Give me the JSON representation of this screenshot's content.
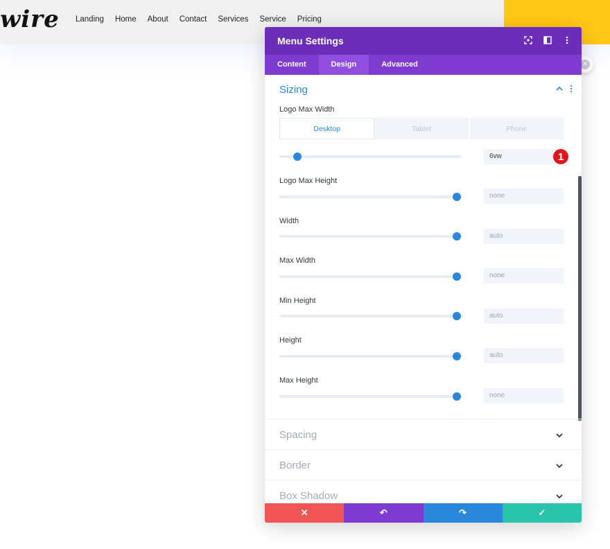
{
  "site": {
    "logo_text": "wire",
    "nav": [
      "Landing",
      "Home",
      "About",
      "Contact",
      "Services",
      "Service",
      "Pricing"
    ],
    "accent_yellow": "#ffc816"
  },
  "modal": {
    "title": "Menu Settings",
    "header_icons": [
      "screenshot-icon",
      "split-view-icon",
      "more-options-icon"
    ],
    "tabs": [
      "Content",
      "Design",
      "Advanced"
    ],
    "active_tab": "Design",
    "colors": {
      "header": "#6c2eb9",
      "tabs": "#7e3bd0",
      "accent": "#2b87da"
    },
    "sizing": {
      "title": "Sizing",
      "logo_max_width": {
        "label": "Logo Max Width",
        "devices": [
          "Desktop",
          "Tablet",
          "Phone"
        ],
        "active_device": "Desktop",
        "value": "6vw",
        "slider_level": 0.08
      },
      "badge": "1",
      "fields": [
        {
          "label": "Logo Max Height",
          "value": "none",
          "slider_level": 1.0
        },
        {
          "label": "Width",
          "value": "auto",
          "slider_level": 1.0
        },
        {
          "label": "Max Width",
          "value": "none",
          "slider_level": 1.0
        },
        {
          "label": "Min Height",
          "value": "auto",
          "slider_level": 1.0
        },
        {
          "label": "Height",
          "value": "auto",
          "slider_level": 1.0
        },
        {
          "label": "Max Height",
          "value": "none",
          "slider_level": 1.0
        }
      ]
    },
    "collapsed_sections": [
      "Spacing",
      "Border",
      "Box Shadow"
    ],
    "footer": {
      "buttons": [
        {
          "name": "cancel-button",
          "icon": "close-icon",
          "glyph": "✕",
          "color": "#ef5555"
        },
        {
          "name": "undo-button",
          "icon": "undo-icon",
          "glyph": "↶",
          "color": "#7d3bcf"
        },
        {
          "name": "redo-button",
          "icon": "redo-icon",
          "glyph": "↷",
          "color": "#2b87da"
        },
        {
          "name": "save-button",
          "icon": "check-icon",
          "glyph": "✓",
          "color": "#29c4a9"
        }
      ]
    }
  }
}
